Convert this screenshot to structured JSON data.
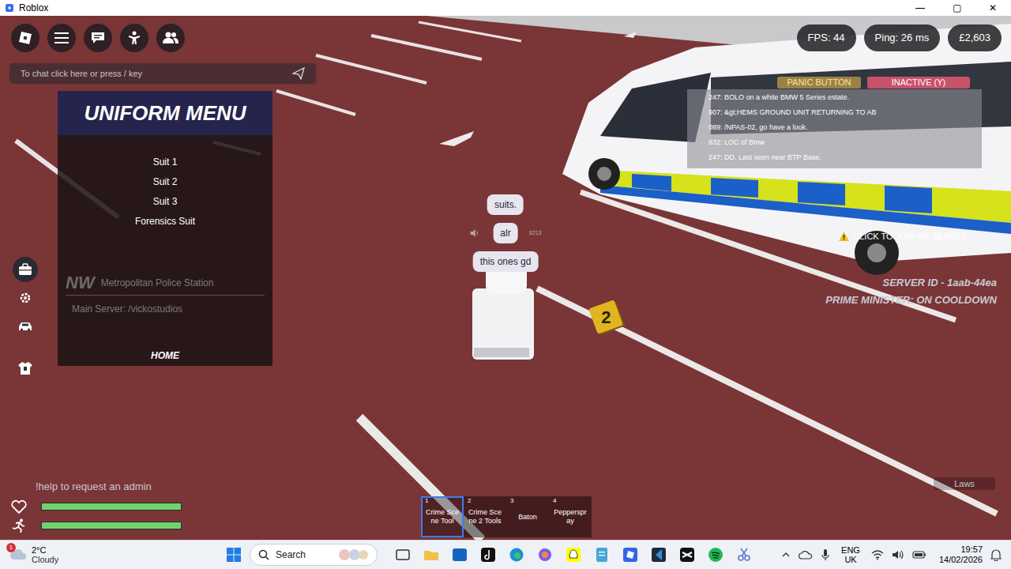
{
  "window": {
    "title": "Roblox",
    "controls": [
      "—",
      "▢",
      "✕"
    ]
  },
  "chat": {
    "placeholder": "To chat click here or press / key"
  },
  "stats": [
    "FPS: 44",
    "Ping: 26 ms",
    "£2,603"
  ],
  "panic_button": "PANIC BUTTON",
  "duty_status": "INACTIVE (Y)",
  "radio_log": [
    "247: BOLO on a white BMW 5 Series estate.",
    "907: &gt;HEMS GROUND UNIT RETURNING TO AB",
    "089: /NPAS-02, go have a look.",
    "832: LOC of Bmw",
    "247: DD. Last seen near BTP Base."
  ],
  "uniform_menu": {
    "title": "UNIFORM MENU",
    "items": [
      "Suit 1",
      "Suit 2",
      "Suit 3",
      "Forensics Suit"
    ],
    "station_logo": "NW",
    "station": "Metropolitan Police Station",
    "server": "Main Server: /vickostudios",
    "home": "HOME"
  },
  "side_tools": [
    {
      "name": "briefcase",
      "selected": true
    },
    {
      "name": "settings",
      "selected": false
    },
    {
      "name": "vehicle",
      "selected": false
    },
    {
      "name": "uniform",
      "selected": false
    }
  ],
  "bubbles": [
    {
      "text": "suits.",
      "tag": ""
    },
    {
      "text": "alr",
      "tag": "8213"
    },
    {
      "text": "this ones gd",
      "tag": ""
    }
  ],
  "evidence_marker": "2",
  "join_rp": "CLICK TO JOIN RP SERVER",
  "server_id": "SERVER ID - 1aab-44ea",
  "prime_minister": "PRIME MINISTER: ON COOLDOWN",
  "help": "!help to request an admin",
  "vitals": [
    {
      "name": "health",
      "level": 1
    },
    {
      "name": "stamina",
      "level": 1
    }
  ],
  "hotbar": [
    {
      "key": "1",
      "label": "Crime Scene Tool",
      "selected": true
    },
    {
      "key": "2",
      "label": "Crime Scene 2 Tools",
      "selected": false
    },
    {
      "key": "3",
      "label": "Baton",
      "selected": false
    },
    {
      "key": "4",
      "label": "Pepperspray",
      "selected": false
    }
  ],
  "laws": "Laws",
  "taskbar": {
    "weather": {
      "temp": "2°C",
      "condition": "Cloudy",
      "badge": "1"
    },
    "search": "Search",
    "lang": "ENG",
    "region": "UK",
    "time": "19:57",
    "date": "14/02/2026"
  }
}
